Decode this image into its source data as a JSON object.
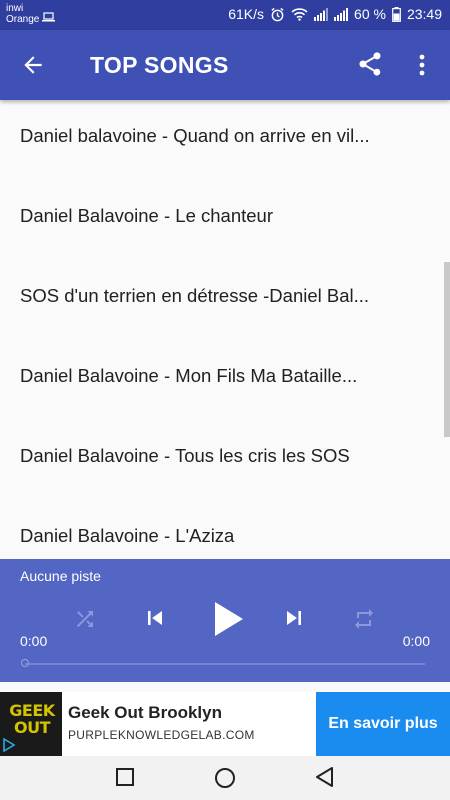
{
  "status_bar": {
    "carrier_1": "inwi",
    "carrier_2": "Orange",
    "speed": "61K/s",
    "battery": "60 %",
    "time": "23:49",
    "icons": [
      "laptop-icon",
      "alarm-icon",
      "wifi-icon",
      "signal-icon",
      "battery-icon"
    ]
  },
  "app_bar": {
    "title": "TOP SONGS",
    "icons": [
      "back-arrow-icon",
      "share-icon",
      "more-vert-icon"
    ],
    "color": "#3f51b5"
  },
  "songs": [
    "Daniel balavoine - Quand on arrive en vil...",
    "Daniel Balavoine - Le chanteur",
    "SOS d'un terrien en détresse -Daniel Bal...",
    "Daniel Balavoine - Mon Fils Ma Bataille...",
    "Daniel Balavoine - Tous les cris les SOS",
    "Daniel Balavoine - L'Aziza"
  ],
  "player": {
    "track": "Aucune piste",
    "elapsed": "0:00",
    "duration": "0:00",
    "progress": 0,
    "icons": [
      "shuffle-icon",
      "previous-icon",
      "play-icon",
      "next-icon",
      "repeat-icon"
    ],
    "color": "#5466c3"
  },
  "ad": {
    "logo_text": "GEEK OUT",
    "title": "Geek Out Brooklyn",
    "url": "PURPLEKNOWLEDGELAB.COM",
    "cta": "En savoir plus",
    "cta_color": "#1a8cf0"
  },
  "nav_bar": {
    "icons": [
      "recents-icon",
      "home-icon",
      "back-icon"
    ]
  }
}
